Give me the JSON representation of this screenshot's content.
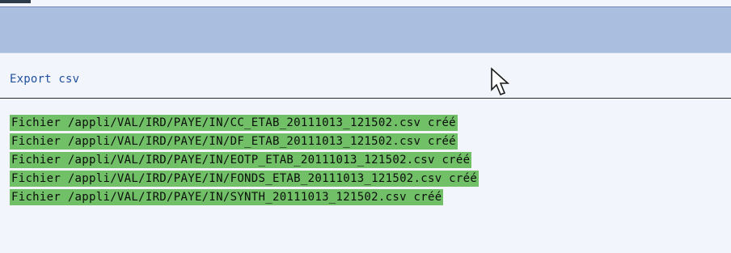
{
  "page": {
    "title": "Export csv"
  },
  "messages": [
    "Fichier /appli/VAL/IRD/PAYE/IN/CC_ETAB_20111013_121502.csv créé",
    "Fichier /appli/VAL/IRD/PAYE/IN/DF_ETAB_20111013_121502.csv créé",
    "Fichier /appli/VAL/IRD/PAYE/IN/EOTP_ETAB_20111013_121502.csv créé",
    "Fichier /appli/VAL/IRD/PAYE/IN/FONDS_ETAB_20111013_121502.csv créé",
    "Fichier /appli/VAL/IRD/PAYE/IN/SYNTH_20111013_121502.csv créé"
  ],
  "colors": {
    "toolbar": "#aabfe0",
    "title": "#1f4f9e",
    "success_highlight": "#71c067",
    "background": "#f2f5fb"
  },
  "icons": {
    "cursor": "mouse-pointer-icon"
  }
}
